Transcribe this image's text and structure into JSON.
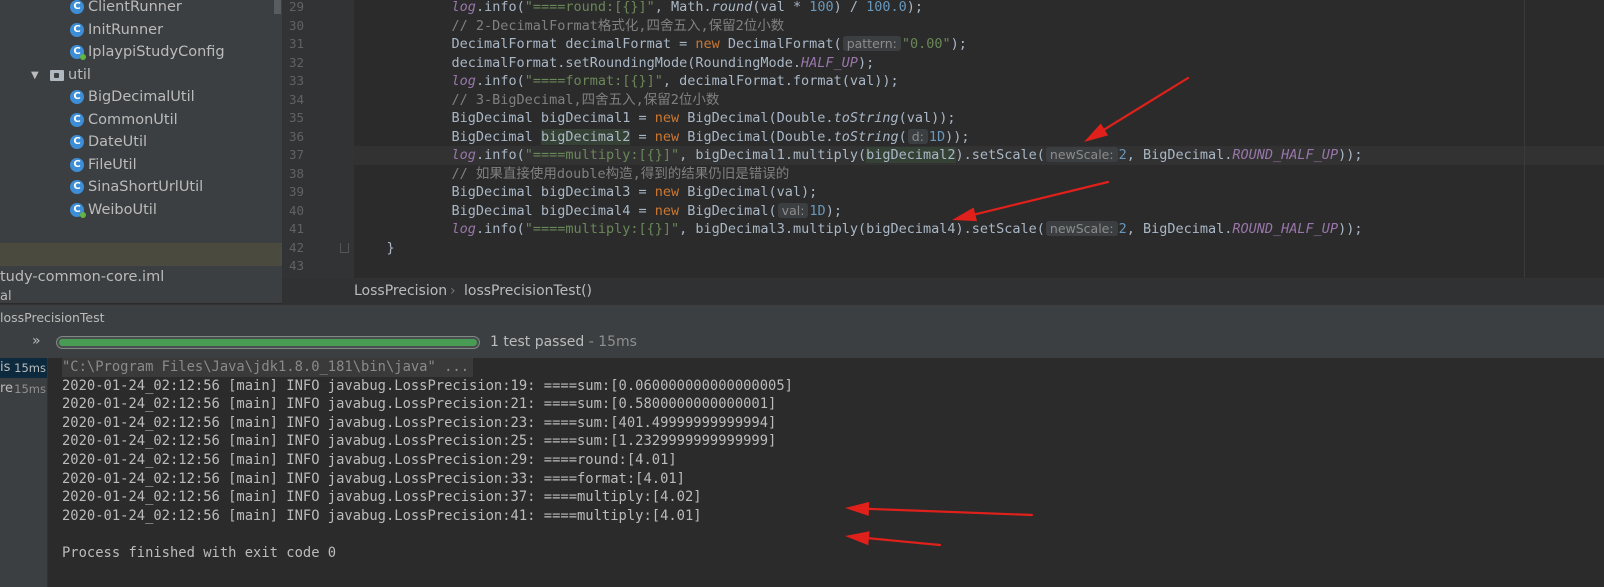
{
  "project_tree": {
    "items": [
      {
        "label": "ClientRunner",
        "icon": "class-icon"
      },
      {
        "label": "InitRunner",
        "icon": "class-icon"
      },
      {
        "label": "IplaypiStudyConfig",
        "icon": "config-class-icon"
      },
      {
        "label": "util",
        "icon": "package-folder-icon"
      },
      {
        "label": "BigDecimalUtil",
        "icon": "class-icon"
      },
      {
        "label": "CommonUtil",
        "icon": "class-icon"
      },
      {
        "label": "DateUtil",
        "icon": "class-icon"
      },
      {
        "label": "FileUtil",
        "icon": "class-icon"
      },
      {
        "label": "SinaShortUrlUtil",
        "icon": "class-icon"
      },
      {
        "label": "WeiboUtil",
        "icon": "class-icon"
      }
    ],
    "iml_file": "tudy-common-core.iml",
    "lib_fragment": "al",
    "class_icon_letter": "C"
  },
  "editor": {
    "line_numbers": [
      "29",
      "30",
      "31",
      "32",
      "33",
      "34",
      "35",
      "36",
      "37",
      "38",
      "39",
      "40",
      "41",
      "42",
      "43"
    ],
    "l29": {
      "a": "            ",
      "fn": "log",
      "b": ".info(",
      "str": "\"====round:[{}]\"",
      "c": ", Math.",
      "fn2": "round",
      "d": "(val * ",
      "n1": "100",
      "e": ") / ",
      "n2": "100.0",
      "f": ");"
    },
    "l30": "            // 2-DecimalFormat格式化,四舍五入,保留2位小数",
    "l31": {
      "a": "            DecimalFormat decimalFormat = ",
      "kw": "new",
      "b": " DecimalFormat(",
      "hint": "pattern:",
      "str": "\"0.00\"",
      "c": ");"
    },
    "l32": {
      "a": "            decimalFormat.setRoundingMode(RoundingMode.",
      "const": "HALF_UP",
      "b": ");"
    },
    "l33": {
      "a": "            ",
      "fn": "log",
      "b": ".info(",
      "str": "\"====format:[{}]\"",
      "c": ", decimalFormat.format(val));"
    },
    "l34": "            // 3-BigDecimal,四舍五入,保留2位小数",
    "l35": {
      "a": "            BigDecimal bigDecimal1 = ",
      "kw": "new",
      "b": " BigDecimal(Double.",
      "st": "toString",
      "c": "(val));"
    },
    "l36": {
      "a": "            BigDecimal ",
      "var": "bigDecimal2",
      "b": " = ",
      "kw": "new",
      "c": " BigDecimal(Double.",
      "st": "toString",
      "d": "(",
      "hint": "d:",
      "num": "1D",
      "e": "));"
    },
    "l37": {
      "a": "            ",
      "fn": "log",
      "b": ".info(",
      "str": "\"====multiply:[{}]\"",
      "c": ", bigDecimal1.multiply(",
      "var": "bigDecimal2",
      "d": ").setScale(",
      "hint": "newScale:",
      "num": "2",
      "e": ", BigDecimal.",
      "const": "ROUND_HALF_UP",
      "f": "));"
    },
    "l38": "            // 如果直接使用double构造,得到的结果仍旧是错误的",
    "l39": {
      "a": "            BigDecimal bigDecimal3 = ",
      "kw": "new",
      "b": " BigDecimal(val);"
    },
    "l40": {
      "a": "            BigDecimal bigDecimal4 = ",
      "kw": "new",
      "b": " BigDecimal(",
      "hint": "val:",
      "num": "1D",
      "c": ");"
    },
    "l41": {
      "a": "            ",
      "fn": "log",
      "b": ".info(",
      "str": "\"====multiply:[{}]\"",
      "c": ", bigDecimal3.multiply(bigDecimal4).setScale(",
      "hint": "newScale:",
      "num": "2",
      "d": ", BigDecimal.",
      "const": "ROUND_HALF_UP",
      "e": "));"
    },
    "l42": "    }",
    "l43": ""
  },
  "breadcrumb": {
    "class": "LossPrecision",
    "separator": "›",
    "method": "lossPrecisionTest()"
  },
  "run_panel": {
    "title": "lossPrecisionTest",
    "expand_symbol": "»",
    "progress": 1.0,
    "status": "1 test passed",
    "duration": "- 15ms",
    "tests": [
      {
        "name": "is",
        "time": "15ms"
      },
      {
        "name": "re",
        "time": "15ms"
      }
    ]
  },
  "console": {
    "lines": [
      "\"C:\\Program Files\\Java\\jdk1.8.0_181\\bin\\java\" ...",
      "2020-01-24_02:12:56 [main] INFO javabug.LossPrecision:19: ====sum:[0.060000000000000005]",
      "2020-01-24_02:12:56 [main] INFO javabug.LossPrecision:21: ====sum:[0.5800000000000001]",
      "2020-01-24_02:12:56 [main] INFO javabug.LossPrecision:23: ====sum:[401.49999999999994]",
      "2020-01-24_02:12:56 [main] INFO javabug.LossPrecision:25: ====sum:[1.2329999999999999]",
      "2020-01-24_02:12:56 [main] INFO javabug.LossPrecision:29: ====round:[4.01]",
      "2020-01-24_02:12:56 [main] INFO javabug.LossPrecision:33: ====format:[4.01]",
      "2020-01-24_02:12:56 [main] INFO javabug.LossPrecision:37: ====multiply:[4.02]",
      "2020-01-24_02:12:56 [main] INFO javabug.LossPrecision:41: ====multiply:[4.01]",
      "",
      "Process finished with exit code 0"
    ]
  },
  "colors": {
    "annotation_arrow": "#e0201a",
    "progress_green": "#499c54",
    "keyword": "#cc7832",
    "string": "#6a8759",
    "number": "#6897bb"
  }
}
